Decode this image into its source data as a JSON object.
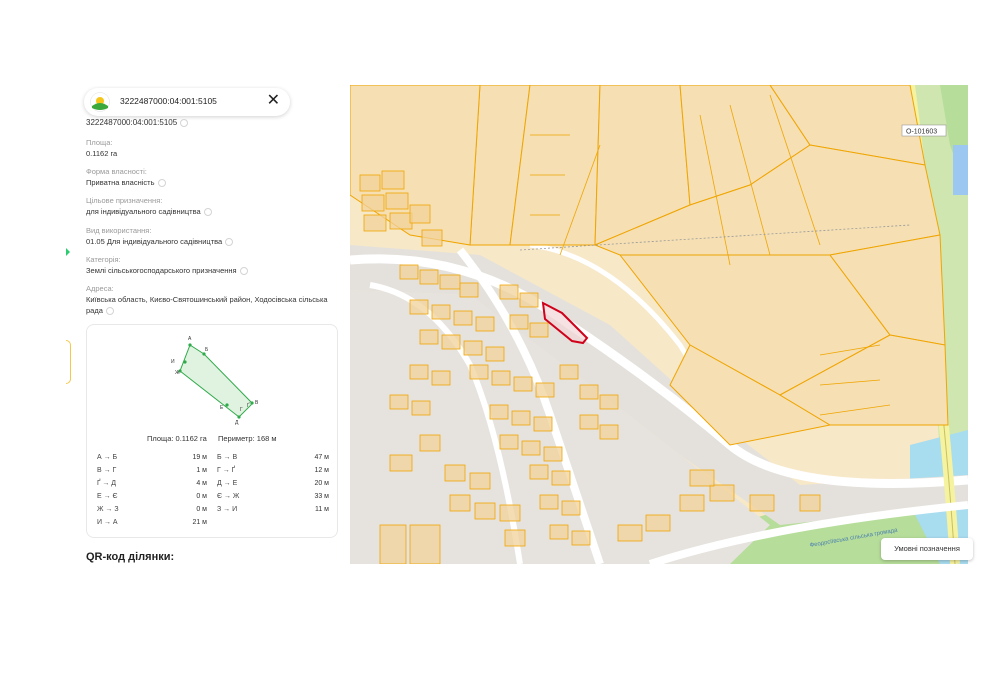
{
  "search": {
    "query": "3222487000:04:001:5105"
  },
  "parcel": {
    "cadastral_number": "3222487000:04:001:5105",
    "fields": [
      {
        "label": "Площа:",
        "value": "0.1162 га"
      },
      {
        "label": "Форма власності:",
        "value": "Приватна власність"
      },
      {
        "label": "Цільове призначення:",
        "value": "для індивідуального садівництва"
      },
      {
        "label": "Вид використання:",
        "value": "01.05 Для індивідуального садівництва"
      },
      {
        "label": "Категорія:",
        "value": "Землі сільськогосподарського призначення"
      },
      {
        "label": "Адреса:",
        "value": "Київська область, Києво-Святошинський район, Ходосівська сільська рада"
      }
    ],
    "shape": {
      "vertices": [
        "А",
        "Б",
        "В",
        "Г",
        "Ґ",
        "Д",
        "Е",
        "Є",
        "Ж",
        "З",
        "И"
      ],
      "area_label": "Площа:",
      "area_value": "0.1162 га",
      "perimeter_label": "Периметр:",
      "perimeter_value": "168 м"
    },
    "edges": [
      {
        "label": "А → Б",
        "value": "19 м"
      },
      {
        "label": "Б → В",
        "value": "47 м"
      },
      {
        "label": "В → Г",
        "value": "1 м"
      },
      {
        "label": "Г → Ґ",
        "value": "12 м"
      },
      {
        "label": "Ґ → Д",
        "value": "4 м"
      },
      {
        "label": "Д → Е",
        "value": "20 м"
      },
      {
        "label": "Е → Є",
        "value": "0 м"
      },
      {
        "label": "Є → Ж",
        "value": "33 м"
      },
      {
        "label": "Ж → З",
        "value": "0 м"
      },
      {
        "label": "З → И",
        "value": "11 м"
      },
      {
        "label": "И → А",
        "value": "21 м"
      }
    ],
    "qr_title": "QR-код ділянки:"
  },
  "map": {
    "road_code": "О-101603",
    "street_label": "Феодосіївська сільська громада",
    "legend_button": "Умовні позначення",
    "colors": {
      "parcel_fill": "#f5dfb3",
      "parcel_border": "#f0a500",
      "selected_border": "#d0021b",
      "green": "#b6dd9a",
      "water": "#a8dcef",
      "road": "#ffffff"
    }
  }
}
